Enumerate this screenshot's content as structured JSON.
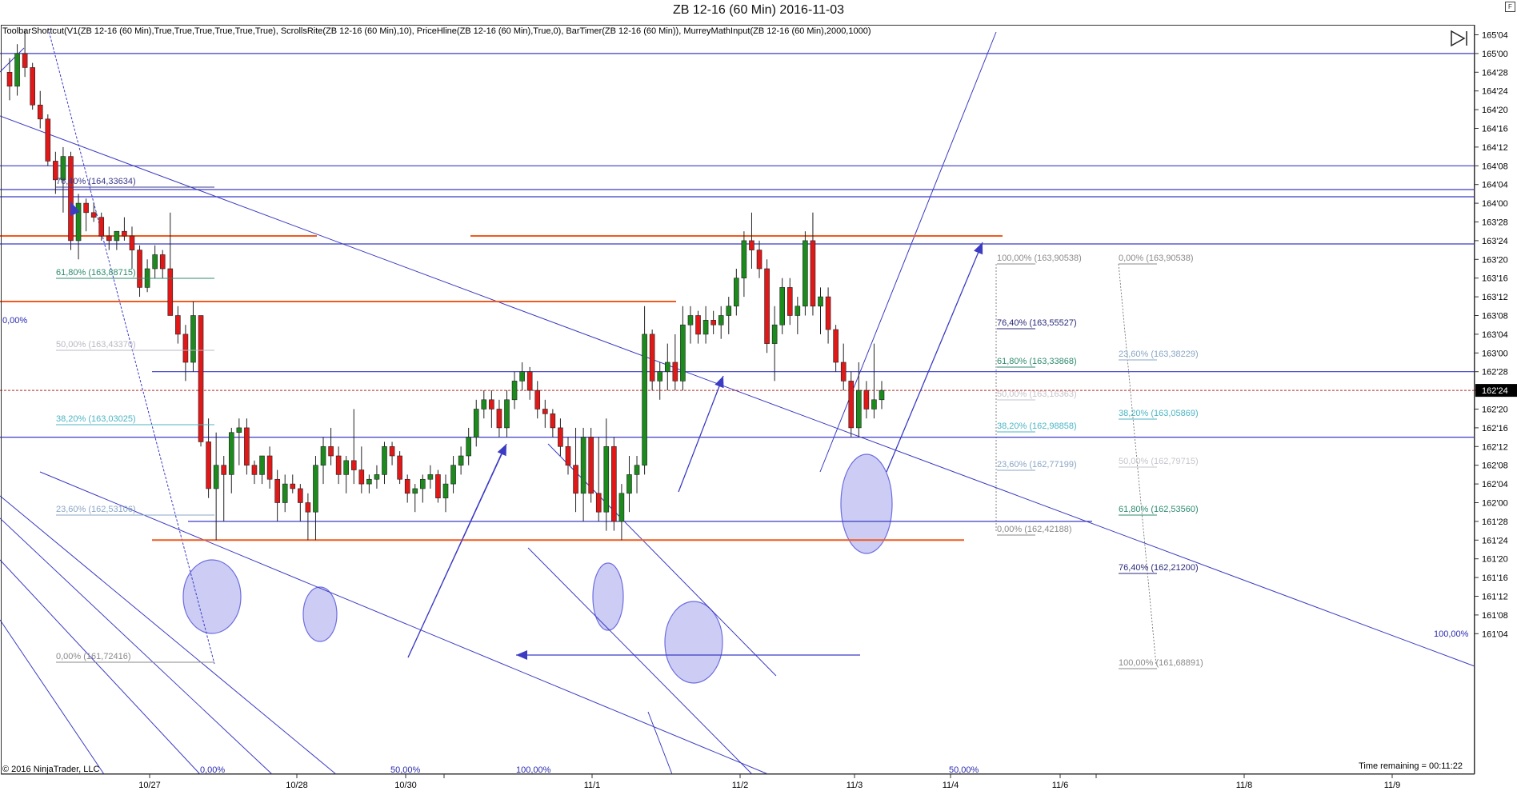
{
  "header": {
    "title": "ZB 12-16 (60 Min)  2016-11-03"
  },
  "indicator_line": "ToolbarShortcut(V1(ZB 12-16 (60 Min),True,True,True,True,True,True), ScrollsRite(ZB 12-16 (60 Min),10), PriceHline(ZB 12-16 (60 Min),True,0), BarTimer(ZB 12-16 (60 Min)), MurreyMathInput(ZB 12-16 (60 Min),2000,1000)",
  "footer": {
    "copyright": "© 2016 NinjaTrader, LLC",
    "time_remaining": "Time remaining = 00:11:22",
    "corner_button": "F"
  },
  "chart_data": {
    "type": "candlestick",
    "instrument": "ZB 12-16",
    "interval": "60 Min",
    "y_axis": {
      "ticks": [
        "165'04",
        "165'00",
        "164'28",
        "164'24",
        "164'20",
        "164'16",
        "164'12",
        "164'08",
        "164'04",
        "164'00",
        "163'28",
        "163'24",
        "163'20",
        "163'16",
        "163'12",
        "163'08",
        "163'04",
        "163'00",
        "162'28",
        "162'24",
        "162'20",
        "162'16",
        "162'12",
        "162'08",
        "162'04",
        "162'00",
        "161'28",
        "161'24",
        "161'20",
        "161'16",
        "161'12",
        "161'08",
        "161'04"
      ],
      "current_price": "162'24"
    },
    "x_axis": {
      "ticks": [
        "10/27",
        "10/28",
        "10/30",
        "11/1",
        "11/2",
        "11/3",
        "11/4",
        "11/6",
        "11/8",
        "11/9"
      ]
    },
    "candles_ohlc": [
      [
        164.28,
        164.31,
        164.22,
        164.25
      ],
      [
        164.25,
        165.02,
        164.23,
        165.0
      ],
      [
        165.0,
        165.05,
        164.27,
        164.29
      ],
      [
        164.29,
        164.3,
        164.2,
        164.21
      ],
      [
        164.21,
        164.24,
        164.16,
        164.18
      ],
      [
        164.18,
        164.19,
        164.08,
        164.09
      ],
      [
        164.09,
        164.11,
        164.02,
        164.05
      ],
      [
        164.05,
        164.12,
        163.3,
        164.1
      ],
      [
        164.1,
        164.11,
        163.22,
        163.24
      ],
      [
        163.24,
        164.02,
        163.2,
        164.0
      ],
      [
        164.0,
        164.01,
        163.26,
        163.3
      ],
      [
        163.3,
        164.0,
        163.28,
        163.29
      ],
      [
        163.29,
        163.3,
        163.24,
        163.25
      ],
      [
        163.25,
        163.27,
        163.22,
        163.24
      ],
      [
        163.24,
        163.26,
        163.22,
        163.26
      ],
      [
        163.26,
        163.29,
        163.24,
        163.25
      ],
      [
        163.25,
        163.27,
        163.18,
        163.22
      ],
      [
        163.22,
        163.23,
        163.12,
        163.14
      ],
      [
        163.14,
        163.2,
        163.13,
        163.18
      ],
      [
        163.18,
        163.23,
        163.16,
        163.21
      ],
      [
        163.21,
        163.22,
        163.16,
        163.18
      ],
      [
        163.18,
        163.3,
        163.1,
        163.08
      ],
      [
        163.08,
        163.1,
        163.02,
        163.04
      ],
      [
        163.04,
        163.06,
        162.26,
        162.3
      ],
      [
        162.3,
        163.11,
        162.28,
        163.08
      ],
      [
        163.08,
        163.08,
        162.12,
        162.13
      ],
      [
        162.13,
        162.18,
        162.01,
        162.03
      ],
      [
        162.03,
        162.15,
        161.24,
        162.08
      ],
      [
        162.08,
        162.1,
        161.28,
        162.06
      ],
      [
        162.06,
        162.16,
        162.02,
        162.15
      ],
      [
        162.15,
        162.18,
        162.08,
        162.16
      ],
      [
        162.16,
        162.18,
        162.06,
        162.08
      ],
      [
        162.08,
        162.09,
        162.04,
        162.06
      ],
      [
        162.06,
        162.1,
        162.04,
        162.1
      ],
      [
        162.1,
        162.12,
        162.03,
        162.05
      ],
      [
        162.05,
        162.07,
        161.28,
        162.0
      ],
      [
        162.0,
        162.06,
        161.3,
        162.04
      ],
      [
        162.04,
        162.06,
        162.02,
        162.03
      ],
      [
        162.03,
        162.04,
        161.28,
        162.0
      ],
      [
        162.0,
        162.02,
        161.24,
        161.3
      ],
      [
        161.3,
        162.1,
        161.24,
        162.08
      ],
      [
        162.08,
        162.14,
        162.04,
        162.12
      ],
      [
        162.12,
        162.16,
        162.08,
        162.1
      ],
      [
        162.1,
        162.12,
        162.04,
        162.06
      ],
      [
        162.06,
        162.1,
        162.02,
        162.09
      ],
      [
        162.09,
        162.2,
        162.04,
        162.07
      ],
      [
        162.07,
        162.12,
        162.02,
        162.04
      ],
      [
        162.04,
        162.06,
        162.02,
        162.05
      ],
      [
        162.05,
        162.08,
        162.03,
        162.06
      ],
      [
        162.06,
        162.13,
        162.04,
        162.12
      ],
      [
        162.12,
        162.13,
        162.08,
        162.1
      ],
      [
        162.1,
        162.11,
        162.04,
        162.05
      ],
      [
        162.05,
        162.06,
        162.0,
        162.02
      ],
      [
        162.02,
        162.04,
        161.3,
        162.03
      ],
      [
        162.03,
        162.06,
        162.0,
        162.05
      ],
      [
        162.05,
        162.08,
        162.03,
        162.06
      ],
      [
        162.06,
        162.07,
        162.0,
        162.01
      ],
      [
        162.01,
        162.06,
        161.3,
        162.04
      ],
      [
        162.04,
        162.1,
        162.02,
        162.08
      ],
      [
        162.08,
        162.12,
        162.06,
        162.1
      ],
      [
        162.1,
        162.16,
        162.08,
        162.14
      ],
      [
        162.14,
        162.22,
        162.12,
        162.2
      ],
      [
        162.2,
        162.24,
        162.18,
        162.22
      ],
      [
        162.22,
        162.24,
        162.16,
        162.2
      ],
      [
        162.2,
        162.22,
        162.14,
        162.16
      ],
      [
        162.16,
        162.24,
        162.14,
        162.22
      ],
      [
        162.22,
        162.28,
        162.2,
        162.26
      ],
      [
        162.26,
        162.3,
        162.24,
        162.28
      ],
      [
        162.28,
        162.29,
        162.22,
        162.24
      ],
      [
        162.24,
        162.26,
        162.18,
        162.2
      ],
      [
        162.2,
        162.22,
        162.16,
        162.19
      ],
      [
        162.19,
        162.2,
        162.14,
        162.16
      ],
      [
        162.16,
        162.18,
        162.1,
        162.12
      ],
      [
        162.12,
        162.14,
        162.06,
        162.08
      ],
      [
        162.08,
        162.16,
        161.3,
        162.02
      ],
      [
        162.02,
        162.16,
        161.28,
        162.14
      ],
      [
        162.14,
        162.16,
        162.0,
        162.02
      ],
      [
        162.02,
        162.14,
        161.28,
        161.3
      ],
      [
        161.3,
        162.18,
        161.26,
        162.12
      ],
      [
        162.12,
        162.14,
        161.26,
        161.28
      ],
      [
        161.28,
        162.04,
        161.24,
        162.02
      ],
      [
        162.02,
        162.1,
        161.3,
        162.06
      ],
      [
        162.06,
        162.1,
        162.02,
        162.08
      ],
      [
        162.08,
        163.1,
        162.06,
        163.04
      ],
      [
        163.04,
        163.05,
        162.24,
        162.26
      ],
      [
        162.26,
        162.3,
        162.22,
        162.28
      ],
      [
        162.28,
        163.02,
        162.24,
        162.3
      ],
      [
        162.3,
        163.04,
        162.24,
        162.26
      ],
      [
        162.26,
        163.1,
        162.24,
        163.06
      ],
      [
        163.06,
        163.1,
        163.02,
        163.08
      ],
      [
        163.08,
        163.09,
        163.02,
        163.04
      ],
      [
        163.04,
        163.1,
        163.02,
        163.07
      ],
      [
        163.07,
        163.09,
        163.04,
        163.06
      ],
      [
        163.06,
        163.1,
        163.03,
        163.08
      ],
      [
        163.08,
        163.12,
        163.04,
        163.1
      ],
      [
        163.1,
        163.18,
        163.08,
        163.16
      ],
      [
        163.16,
        163.26,
        163.12,
        163.24
      ],
      [
        163.24,
        163.3,
        163.18,
        163.22
      ],
      [
        163.22,
        163.24,
        163.16,
        163.18
      ],
      [
        163.18,
        163.2,
        163.0,
        163.02
      ],
      [
        163.02,
        163.1,
        162.26,
        163.06
      ],
      [
        163.06,
        163.16,
        163.04,
        163.14
      ],
      [
        163.14,
        163.16,
        163.06,
        163.08
      ],
      [
        163.08,
        163.12,
        163.04,
        163.1
      ],
      [
        163.1,
        163.26,
        163.08,
        163.24
      ],
      [
        163.24,
        163.3,
        163.08,
        163.1
      ],
      [
        163.1,
        163.14,
        163.04,
        163.12
      ],
      [
        163.12,
        163.14,
        163.02,
        163.05
      ],
      [
        163.05,
        163.06,
        162.28,
        162.3
      ],
      [
        162.3,
        163.02,
        162.24,
        162.26
      ],
      [
        162.26,
        162.28,
        162.14,
        162.16
      ],
      [
        162.16,
        162.3,
        162.14,
        162.24
      ],
      [
        162.24,
        162.26,
        162.18,
        162.2
      ],
      [
        162.2,
        163.02,
        162.18,
        162.22
      ],
      [
        162.22,
        162.26,
        162.2,
        162.24
      ]
    ],
    "horizontal_lines": [
      {
        "price": 164.32,
        "color": "#3b3bc4"
      },
      {
        "price": 164.08,
        "color": "#3b3bc4"
      },
      {
        "price": 163.25,
        "color": "#f05a1f",
        "span": "left"
      },
      {
        "price": 163.25,
        "color": "#f05a1f",
        "span": "mid"
      },
      {
        "price": 163.11,
        "color": "#f05a1f"
      },
      {
        "price": 162.28,
        "color": "#3b3bc4"
      },
      {
        "price": 162.14,
        "color": "#3b3bc4"
      },
      {
        "price": 161.28,
        "color": "#3b3bc4"
      },
      {
        "price": 161.24,
        "color": "#f05a1f"
      }
    ],
    "fib_levels": [
      {
        "label": "76,40% (164,33634)",
        "color": "#3a3a8a"
      },
      {
        "label": "61,80% (163,88715)",
        "color": "#2d8a6e"
      },
      {
        "label": "50,00% (163,43370)",
        "color": "#b8b8c4"
      },
      {
        "label": "38,20% (163,03025)",
        "color": "#4bb6c4"
      },
      {
        "label": "23,60% (162,53106)",
        "color": "#8aa6c4"
      },
      {
        "label": "0,00% (161,72416)",
        "color": "#8a8a8a"
      },
      {
        "label": "100,00% (163,90538)",
        "color": "#8a8a8a"
      },
      {
        "label": "76,40% (163,55527)",
        "color": "#2a2a7a"
      },
      {
        "label": "61,80% (163,33868)",
        "color": "#2d8a6e"
      },
      {
        "label": "50,00% (163,16363)",
        "color": "#c4c4cc"
      },
      {
        "label": "38,20% (162,98858)",
        "color": "#4bb6c4"
      },
      {
        "label": "23,60% (162,77199)",
        "color": "#8aa6c4"
      },
      {
        "label": "0,00% (162,42188)",
        "color": "#8a8a8a"
      },
      {
        "label": "0,00% (163,90538)",
        "color": "#8a8a8a"
      },
      {
        "label": "23,60% (163,38229)",
        "color": "#8aa6c4"
      },
      {
        "label": "38,20% (163,05869)",
        "color": "#4bb6c4"
      },
      {
        "label": "50,00% (162,79715)",
        "color": "#c4c4cc"
      },
      {
        "label": "61,80% (162,53560)",
        "color": "#2d8a6e"
      },
      {
        "label": "76,40% (162,21200)",
        "color": "#2a2a7a"
      },
      {
        "label": "100,00% (161,68891)",
        "color": "#8a8a8a"
      }
    ],
    "channel_labels": [
      "0,00%",
      "0,00%",
      "50,00%",
      "100,00%",
      "50,00%",
      "100,00%"
    ],
    "colors": {
      "up": "#1c8a1c",
      "down": "#e01818",
      "trend": "#3b3bc4",
      "support": "#f05a1f",
      "ellipse": "#6d6de0"
    }
  }
}
